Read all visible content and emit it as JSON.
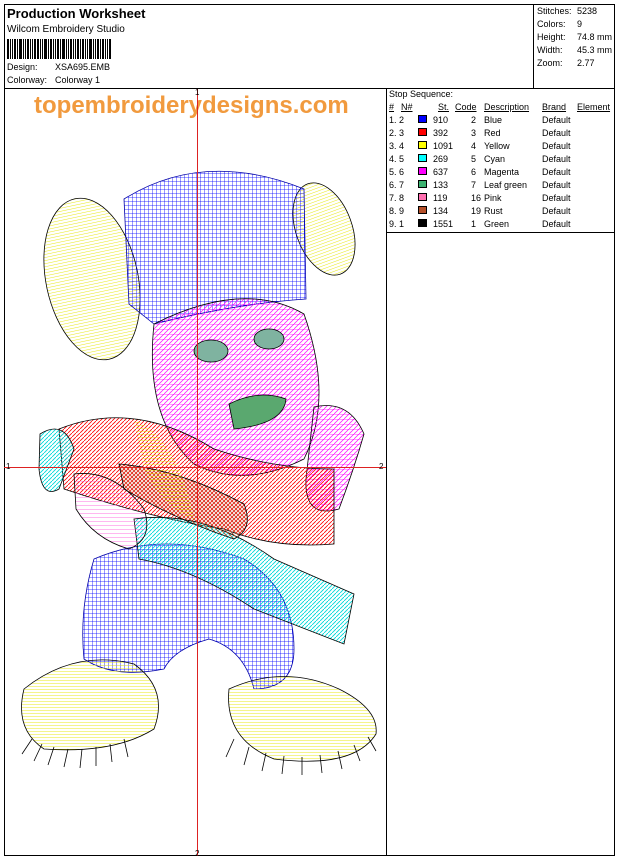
{
  "header": {
    "title": "Production Worksheet",
    "company": "Wilcom Embroidery Studio",
    "design_label": "Design:",
    "design_value": "XSA695.EMB",
    "colorway_label": "Colorway:",
    "colorway_value": "Colorway 1"
  },
  "stats": [
    {
      "label": "Stitches:",
      "value": "5238"
    },
    {
      "label": "Colors:",
      "value": "9"
    },
    {
      "label": "Height:",
      "value": "74.8 mm"
    },
    {
      "label": "Width:",
      "value": "45.3 mm"
    },
    {
      "label": "Zoom:",
      "value": "2.77"
    }
  ],
  "watermark": "topembroiderydesigns.com",
  "axis_labels": {
    "top": "1",
    "left": "1",
    "right": "2",
    "bottom": "2"
  },
  "stop_sequence": {
    "title": "Stop Sequence:",
    "headers": {
      "num": "#",
      "n": "N#",
      "st": "St.",
      "code": "Code",
      "desc": "Description",
      "brand": "Brand",
      "element": "Element"
    },
    "rows": [
      {
        "num": "1.",
        "n": "2",
        "st": "910",
        "code": "2",
        "desc": "Blue",
        "brand": "Default",
        "color": "#0000ff"
      },
      {
        "num": "2.",
        "n": "3",
        "st": "392",
        "code": "3",
        "desc": "Red",
        "brand": "Default",
        "color": "#ff0000"
      },
      {
        "num": "3.",
        "n": "4",
        "st": "1091",
        "code": "4",
        "desc": "Yellow",
        "brand": "Default",
        "color": "#ffff00"
      },
      {
        "num": "4.",
        "n": "5",
        "st": "269",
        "code": "5",
        "desc": "Cyan",
        "brand": "Default",
        "color": "#00ffff"
      },
      {
        "num": "5.",
        "n": "6",
        "st": "637",
        "code": "6",
        "desc": "Magenta",
        "brand": "Default",
        "color": "#ff00ff"
      },
      {
        "num": "6.",
        "n": "7",
        "st": "133",
        "code": "7",
        "desc": "Leaf green",
        "brand": "Default",
        "color": "#3cb371"
      },
      {
        "num": "7.",
        "n": "8",
        "st": "119",
        "code": "16",
        "desc": "Pink",
        "brand": "Default",
        "color": "#ff6fb0"
      },
      {
        "num": "8.",
        "n": "9",
        "st": "134",
        "code": "19",
        "desc": "Rust",
        "brand": "Default",
        "color": "#b5502a"
      },
      {
        "num": "9.",
        "n": "1",
        "st": "1551",
        "code": "1",
        "desc": "Green",
        "brand": "Default",
        "color": "#000000"
      }
    ]
  }
}
